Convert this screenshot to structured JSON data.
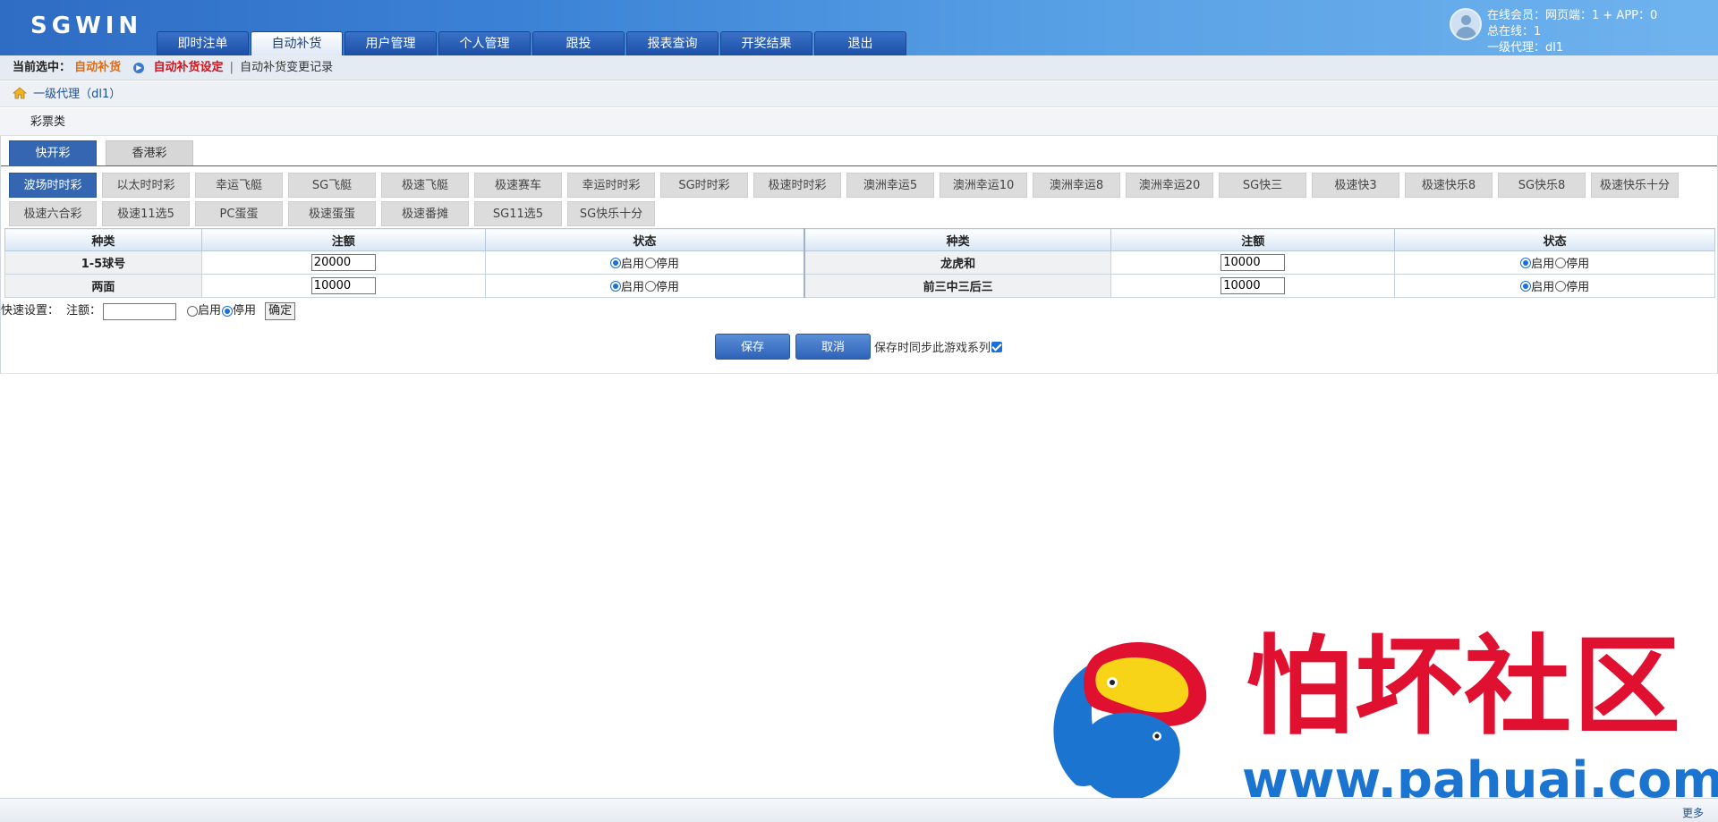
{
  "header": {
    "logo": "SGWIN",
    "nav": [
      "即时注单",
      "自动补货",
      "用户管理",
      "个人管理",
      "跟投",
      "报表查询",
      "开奖结果",
      "退出"
    ],
    "active_nav": 1,
    "user_lines": [
      "在线会员：网页端：1 + APP：0",
      "总在线：1",
      "一级代理：dl1"
    ]
  },
  "breadcrumb": {
    "label": "当前选中：",
    "current": "自动补货",
    "link_active": "自动补货设定",
    "separator": "|",
    "link_other": "自动补货变更记录"
  },
  "agent": {
    "text": "一级代理（dl1）"
  },
  "category": {
    "label": "彩票类"
  },
  "type_tabs": [
    "快开彩",
    "香港彩"
  ],
  "games": [
    "波场时时彩",
    "以太时时彩",
    "幸运飞艇",
    "SG飞艇",
    "极速飞艇",
    "极速赛车",
    "幸运时时彩",
    "SG时时彩",
    "极速时时彩",
    "澳洲幸运5",
    "澳洲幸运10",
    "澳洲幸运8",
    "澳洲幸运20",
    "SG快三",
    "极速快3",
    "极速快乐8",
    "SG快乐8",
    "极速快乐十分",
    "极速六合彩",
    "极速11选5",
    "PC蛋蛋",
    "极速蛋蛋",
    "极速番摊",
    "SG11选5",
    "SG快乐十分"
  ],
  "table": {
    "headers": [
      "种类",
      "注额",
      "状态",
      "种类",
      "注额",
      "状态"
    ],
    "rows": [
      {
        "left_kind": "1-5球号",
        "left_amount": "20000",
        "right_kind": "龙虎和",
        "right_amount": "10000"
      },
      {
        "left_kind": "两面",
        "left_amount": "10000",
        "right_kind": "前三中三后三",
        "right_amount": "10000"
      }
    ],
    "enable_label": "启用",
    "disable_label": "停用"
  },
  "quick_set": {
    "label": "快速设置：",
    "amount_label": "注额：",
    "amount_value": "",
    "enable_label": "启用",
    "disable_label": "停用",
    "confirm": "确定"
  },
  "actions": {
    "save": "保存",
    "cancel": "取消",
    "sync_label": "保存时同步此游戏系列"
  },
  "watermark": {
    "title": "怕坏社区",
    "url": "www.pahuai.com"
  },
  "footer": {
    "more": "更多"
  },
  "colors": {
    "accent": "#3566b2",
    "header": "#3b82d6",
    "highlight": "#e26a12",
    "link_red": "#d0141d"
  }
}
